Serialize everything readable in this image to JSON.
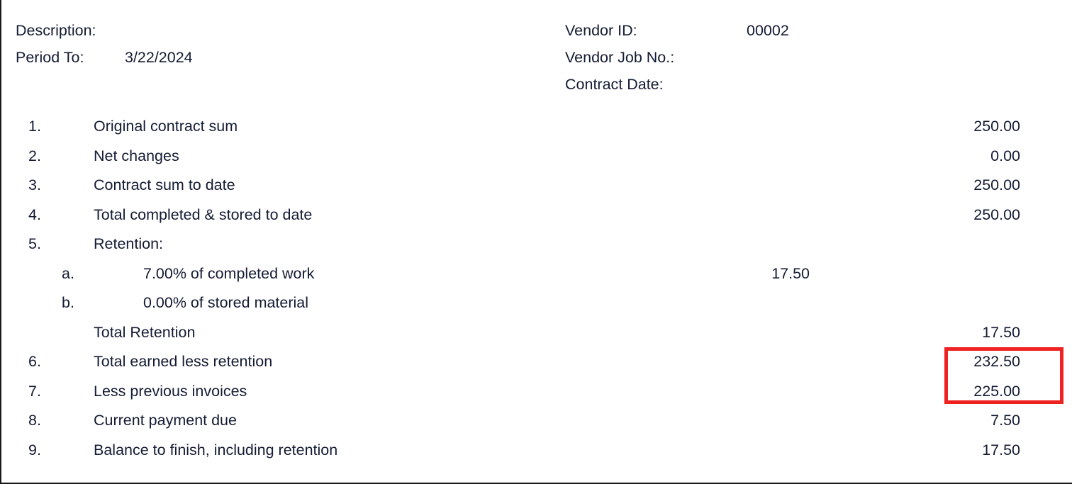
{
  "header": {
    "left_fields": [
      {
        "label": "Description:",
        "value": ""
      },
      {
        "label": "Period To:",
        "value": "3/22/2024"
      }
    ],
    "right_fields": [
      {
        "label": "Vendor ID:",
        "value": "00002"
      },
      {
        "label": "Vendor Job No.:",
        "value": ""
      },
      {
        "label": "Contract Date:",
        "value": ""
      }
    ]
  },
  "line_items": [
    {
      "num": "1.",
      "subnum": "",
      "label": "Original contract sum",
      "mid": "",
      "amount": "250.00"
    },
    {
      "num": "2.",
      "subnum": "",
      "label": "Net changes",
      "mid": "",
      "amount": "0.00"
    },
    {
      "num": "3.",
      "subnum": "",
      "label": "Contract sum to date",
      "mid": "",
      "amount": "250.00"
    },
    {
      "num": "4.",
      "subnum": "",
      "label": "Total completed & stored to date",
      "mid": "",
      "amount": "250.00"
    },
    {
      "num": "5.",
      "subnum": "",
      "label": "Retention:",
      "mid": "",
      "amount": ""
    },
    {
      "num": "",
      "subnum": "a.",
      "label": "7.00% of completed work",
      "mid": "17.50",
      "amount": ""
    },
    {
      "num": "",
      "subnum": "b.",
      "label": "0.00% of stored material",
      "mid": "",
      "amount": ""
    },
    {
      "num": "",
      "subnum": "",
      "label": "Total Retention",
      "mid": "",
      "amount": "17.50"
    },
    {
      "num": "6.",
      "subnum": "",
      "label": "Total earned less retention",
      "mid": "",
      "amount": "232.50"
    },
    {
      "num": "7.",
      "subnum": "",
      "label": "Less previous invoices",
      "mid": "",
      "amount": "225.00"
    },
    {
      "num": "8.",
      "subnum": "",
      "label": "Current payment due",
      "mid": "",
      "amount": "7.50"
    },
    {
      "num": "9.",
      "subnum": "",
      "label": "Balance to finish, including retention",
      "mid": "",
      "amount": "17.50"
    }
  ],
  "annotation": {
    "highlight_color": "#ef2222",
    "highlighted_values": [
      "232.50",
      "225.00"
    ]
  },
  "colors": {
    "text": "#141b33",
    "border": "#1a1a1a",
    "background": "#ffffff"
  }
}
